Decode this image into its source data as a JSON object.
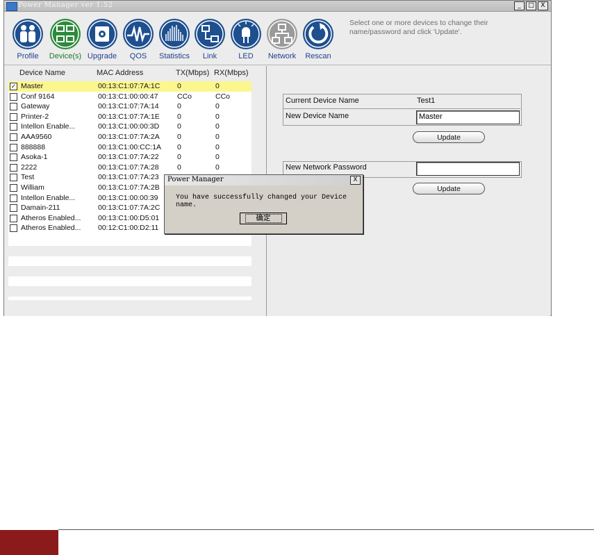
{
  "window": {
    "title": "Power Manager ver 1.52",
    "controls": [
      "_",
      "□",
      "X"
    ]
  },
  "toolbar": {
    "instruction": "Select one or more devices to change their name/password and click 'Update'.",
    "buttons": [
      {
        "label": "Profile",
        "icon": "profile-icon"
      },
      {
        "label": "Device(s)",
        "icon": "devices-icon"
      },
      {
        "label": "Upgrade",
        "icon": "upgrade-icon"
      },
      {
        "label": "QOS",
        "icon": "qos-icon"
      },
      {
        "label": "Statistics",
        "icon": "statistics-icon"
      },
      {
        "label": "Link",
        "icon": "link-icon"
      },
      {
        "label": "LED",
        "icon": "led-icon"
      },
      {
        "label": "Network",
        "icon": "network-icon"
      },
      {
        "label": "Rescan",
        "icon": "rescan-icon"
      }
    ]
  },
  "device_list": {
    "headers": [
      "Device Name",
      "MAC Address",
      "TX(Mbps)",
      "RX(Mbps)"
    ],
    "rows": [
      {
        "checked": true,
        "name": "Master",
        "mac": "00:13:C1:07:7A:1C",
        "tx": "0",
        "rx": "0",
        "selected": true
      },
      {
        "checked": false,
        "name": "Conf 9164",
        "mac": "00:13:C1:00:00:47",
        "tx": "CCo",
        "rx": "CCo"
      },
      {
        "checked": false,
        "name": "Gateway",
        "mac": "00:13:C1:07:7A:14",
        "tx": "0",
        "rx": "0"
      },
      {
        "checked": false,
        "name": "Printer-2",
        "mac": "00:13:C1:07:7A:1E",
        "tx": "0",
        "rx": "0"
      },
      {
        "checked": false,
        "name": "Intellon Enable...",
        "mac": "00:13:C1:00:00:3D",
        "tx": "0",
        "rx": "0"
      },
      {
        "checked": false,
        "name": "AAA9560",
        "mac": "00:13:C1:07:7A:2A",
        "tx": "0",
        "rx": "0"
      },
      {
        "checked": false,
        "name": "888888",
        "mac": "00:13:C1:00:CC:1A",
        "tx": "0",
        "rx": "0"
      },
      {
        "checked": false,
        "name": "Asoka-1",
        "mac": "00:13:C1:07:7A:22",
        "tx": "0",
        "rx": "0"
      },
      {
        "checked": false,
        "name": "2222",
        "mac": "00:13:C1:07:7A:28",
        "tx": "0",
        "rx": "0"
      },
      {
        "checked": false,
        "name": "Test",
        "mac": "00:13:C1:07:7A:23",
        "tx": "",
        "rx": ""
      },
      {
        "checked": false,
        "name": "William",
        "mac": "00:13:C1:07:7A:2B",
        "tx": "",
        "rx": ""
      },
      {
        "checked": false,
        "name": "Intellon Enable...",
        "mac": "00:13:C1:00:00:39",
        "tx": "",
        "rx": ""
      },
      {
        "checked": false,
        "name": "Damain-211",
        "mac": "00:13:C1:07:7A:2C",
        "tx": "",
        "rx": ""
      },
      {
        "checked": false,
        "name": "Atheros Enabled...",
        "mac": "00:13:C1:00:D5:01",
        "tx": "",
        "rx": ""
      },
      {
        "checked": false,
        "name": "Atheros Enabled...",
        "mac": "00:12:C1:00:D2:11",
        "tx": "",
        "rx": ""
      }
    ]
  },
  "device_panel": {
    "current_name_label": "Current Device Name",
    "current_name_value": "Test1",
    "new_name_label": "New Device Name",
    "new_name_value": "Master",
    "update_label": "Update",
    "password_label": "New Network Password",
    "password_value": "",
    "update_label_2": "Update"
  },
  "dialog": {
    "title": "Power Manager",
    "message": "You have successfully changed your Device name.",
    "ok_label": "确定",
    "close": "X"
  },
  "colors": {
    "selected_row": "#fcf68e",
    "icon_blue": "#1e4f8f",
    "active_green": "#2c8a3a",
    "footer_red": "#8b1a1a"
  }
}
